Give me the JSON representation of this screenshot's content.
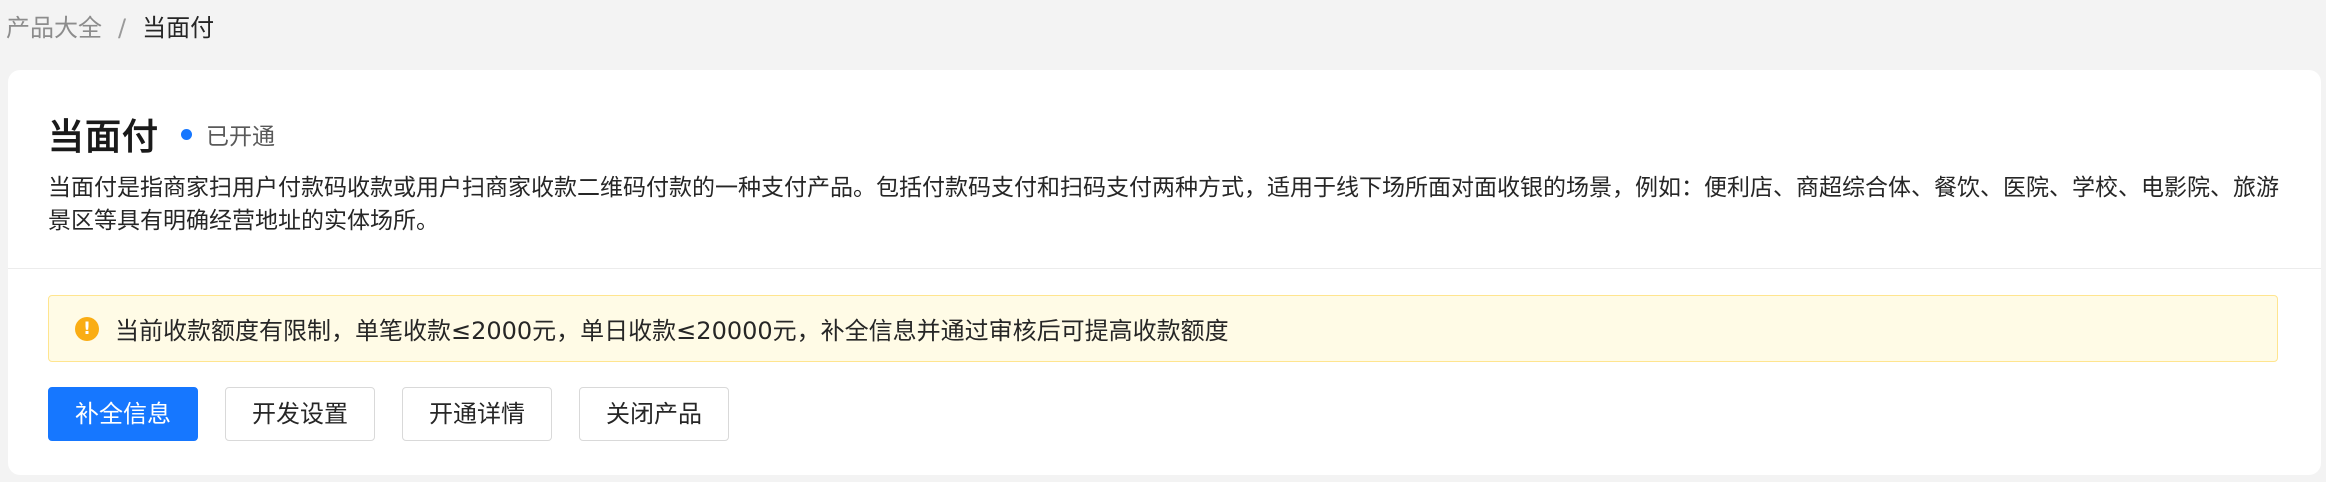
{
  "breadcrumb": {
    "parent": "产品大全",
    "separator": "/",
    "current": "当面付"
  },
  "product": {
    "title": "当面付",
    "status": "已开通",
    "status_color": "#1677ff",
    "description": "当面付是指商家扫用户付款码收款或用户扫商家收款二维码付款的一种支付产品。包括付款码支付和扫码支付两种方式，适用于线下场所面对面收银的场景，例如：便利店、商超综合体、餐饮、医院、学校、电影院、旅游景区等具有明确经营地址的实体场所。"
  },
  "alert": {
    "icon": "exclamation-circle-icon",
    "icon_glyph": "!",
    "icon_color": "#faad14",
    "text": "当前收款额度有限制，单笔收款≤2000元，单日收款≤20000元，补全信息并通过审核后可提高收款额度"
  },
  "actions": {
    "complete_info": "补全信息",
    "dev_settings": "开发设置",
    "activation_details": "开通详情",
    "close_product": "关闭产品"
  },
  "colors": {
    "primary": "#1677ff",
    "warning_bg": "#fffbe6",
    "warning_border": "#ffe58f"
  }
}
